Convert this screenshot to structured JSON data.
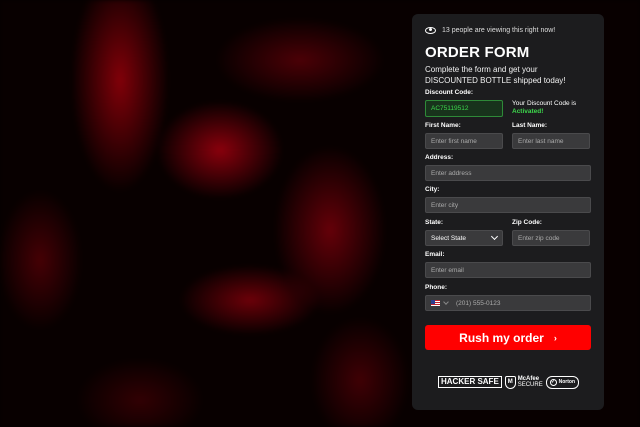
{
  "viewers": {
    "icon": "eye-icon",
    "text": "13 people are viewing this right now!"
  },
  "form": {
    "title": "ORDER FORM",
    "subtitle_line1": "Complete the form and get your",
    "subtitle_line2": "DISCOUNTED BOTTLE shipped today!",
    "discount": {
      "label": "Discount Code:",
      "value": "AC75119512",
      "note_line1": "Your Discount Code is",
      "note_line2": "Activated!"
    },
    "first_name": {
      "label": "First Name:",
      "placeholder": "Enter first name"
    },
    "last_name": {
      "label": "Last Name:",
      "placeholder": "Enter last name"
    },
    "address": {
      "label": "Address:",
      "placeholder": "Enter address"
    },
    "city": {
      "label": "City:",
      "placeholder": "Enter city"
    },
    "state": {
      "label": "State:",
      "selected": "Select State"
    },
    "zip": {
      "label": "Zip Code:",
      "placeholder": "Enter zip code"
    },
    "email": {
      "label": "Email:",
      "placeholder": "Enter email"
    },
    "phone": {
      "label": "Phone:",
      "placeholder": "(201) 555-0123",
      "flag_icon": "us-flag-icon"
    },
    "submit_label": "Rush my order",
    "submit_arrow": "›"
  },
  "trust_badges": {
    "hacker_small": "",
    "hacker_big": "HACKER SAFE",
    "mcafee_line1": "McAfee",
    "mcafee_line2": "SECURE",
    "norton": "Norton"
  },
  "colors": {
    "accent": "#ff0000",
    "success": "#3dd64c",
    "panel": "#1c1c1e"
  }
}
